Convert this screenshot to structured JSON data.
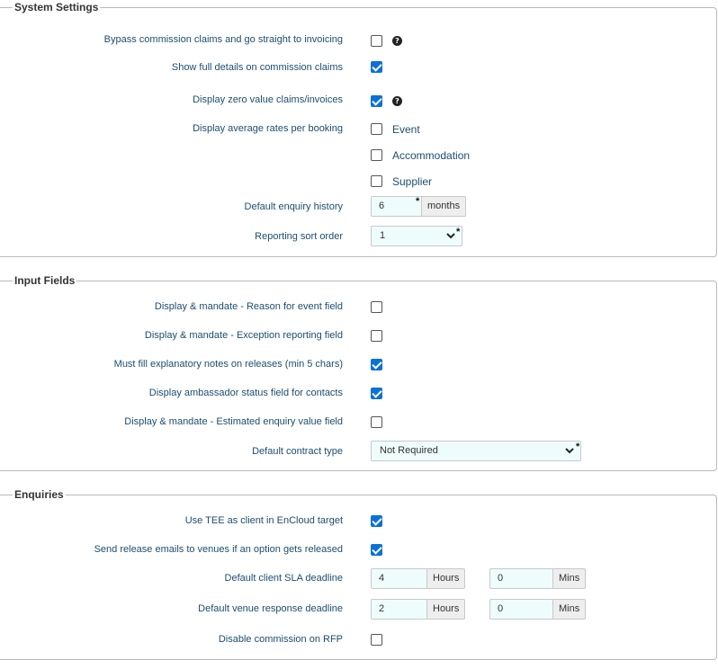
{
  "system_settings": {
    "title": "System Settings",
    "bypass_label": "Bypass commission claims and go straight to invoicing",
    "bypass_checked": false,
    "full_details_label": "Show full details on commission claims",
    "full_details_checked": true,
    "zero_value_label": "Display zero value claims/invoices",
    "zero_value_checked": true,
    "avg_rates_label": "Display average rates per booking",
    "avg_rates_options": [
      {
        "label": "Event",
        "checked": false
      },
      {
        "label": "Accommodation",
        "checked": false
      },
      {
        "label": "Supplier",
        "checked": false
      }
    ],
    "enquiry_history_label": "Default enquiry history",
    "enquiry_history_value": "6",
    "enquiry_history_unit": "months",
    "sort_order_label": "Reporting sort order",
    "sort_order_value": "1"
  },
  "input_fields": {
    "title": "Input Fields",
    "reason_label": "Display & mandate - Reason for event field",
    "reason_checked": false,
    "exception_label": "Display & mandate - Exception reporting field",
    "exception_checked": false,
    "explanatory_label": "Must fill explanatory notes on releases (min 5 chars)",
    "explanatory_checked": true,
    "ambassador_label": "Display ambassador status field for contacts",
    "ambassador_checked": true,
    "estimated_label": "Display & mandate - Estimated enquiry value field",
    "estimated_checked": false,
    "contract_type_label": "Default contract type",
    "contract_type_value": "Not Required"
  },
  "enquiries": {
    "title": "Enquiries",
    "tee_label": "Use TEE as client in EnCloud target",
    "tee_checked": true,
    "release_emails_label": "Send release emails to venues if an option gets released",
    "release_emails_checked": true,
    "client_sla_label": "Default client SLA deadline",
    "client_sla_hours": "4",
    "client_sla_mins": "0",
    "venue_response_label": "Default venue response deadline",
    "venue_response_hours": "2",
    "venue_response_mins": "0",
    "hours_unit": "Hours",
    "mins_unit": "Mins",
    "disable_commission_label": "Disable commission on RFP",
    "disable_commission_checked": false
  },
  "icons": {
    "help": "question-circle-icon",
    "dropdown": "chevron-down-icon",
    "required": "asterisk"
  },
  "colors": {
    "label_text": "#1c4d6e",
    "checkbox_checked": "#0b71d6",
    "input_bg": "#eefcfc",
    "addon_bg": "#eeeeee",
    "border": "#b9b9b9"
  }
}
